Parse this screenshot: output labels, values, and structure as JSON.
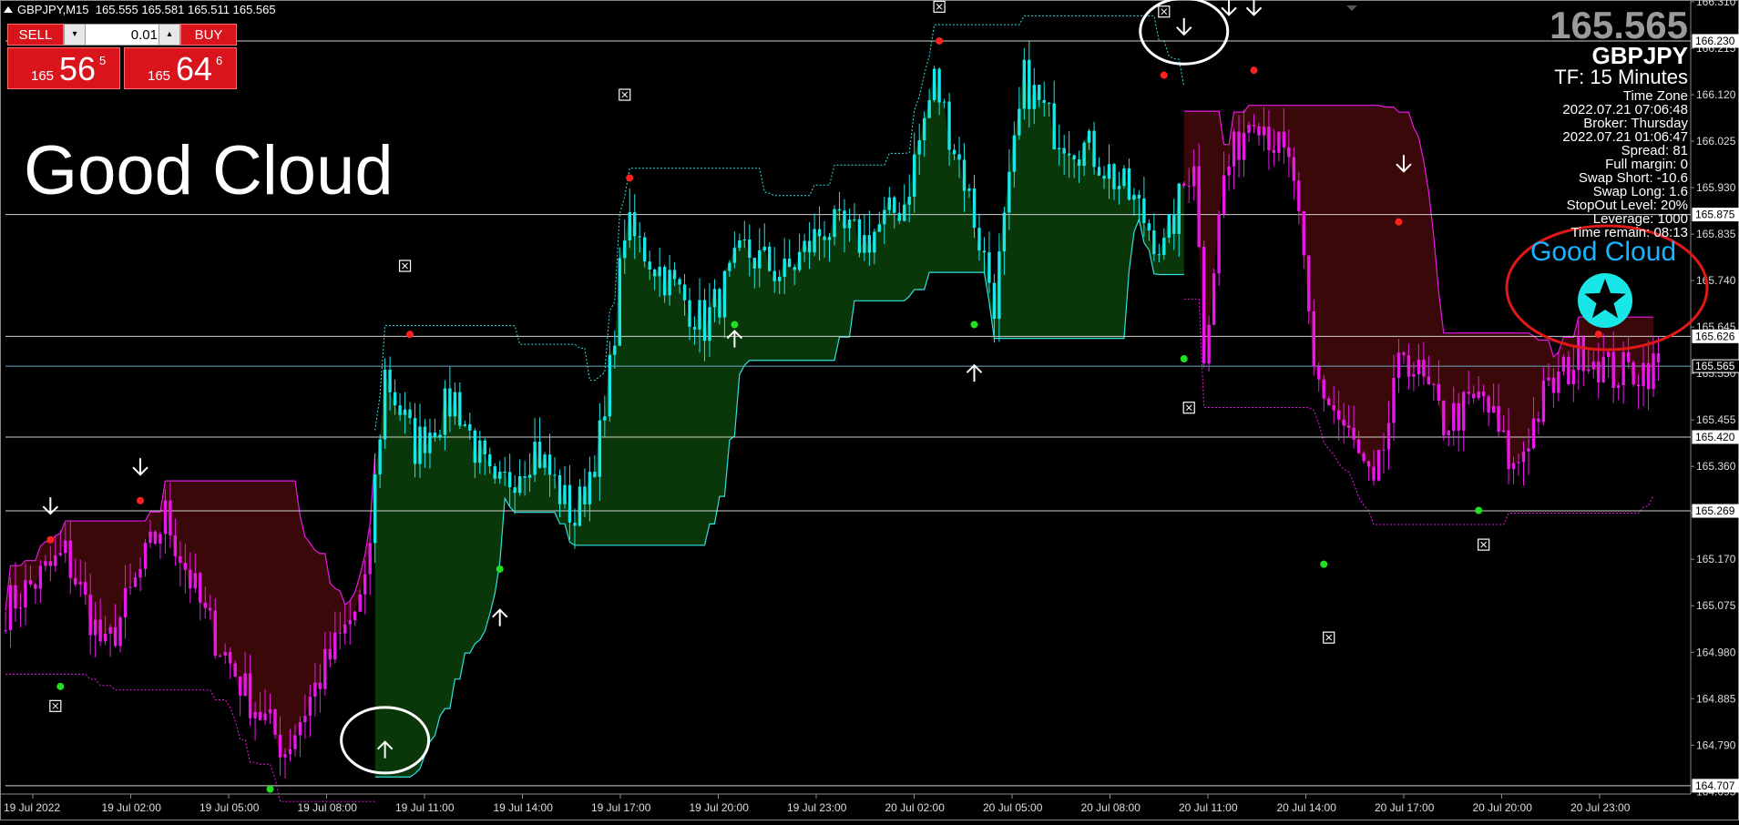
{
  "window": {
    "symbol_header": "GBPJPY,M15",
    "ohlc": "165.555 165.581 165.511 165.565"
  },
  "trade_panel": {
    "sell_label": "SELL",
    "buy_label": "BUY",
    "lot_value": "0.01",
    "sell_price": {
      "small": "165",
      "big": "56",
      "sup": "5"
    },
    "buy_price": {
      "small": "165",
      "big": "64",
      "sup": "6"
    }
  },
  "overlay_title": "Good Cloud",
  "info_panel": {
    "current_price": "165.565",
    "symbol": "GBPJPY",
    "timeframe": "TF: 15 Minutes",
    "rows": [
      "Time Zone",
      "2022.07.21 07:06:48",
      "Broker: Thursday",
      "2022.07.21 01:06:47",
      "Spread:     81",
      "Full margin:       0",
      "Swap Short:  -10.6",
      "Swap Long:     1.6",
      "StopOut Level:  20%",
      "Leverage:  1000",
      "Time remain: 08:13"
    ]
  },
  "indicator_label": "Good Cloud",
  "colors": {
    "background": "#000000",
    "bull_candle": "#19e6e6",
    "bear_candle": "#e619e6",
    "bull_cloud": "#0b3a0b",
    "bear_cloud": "#3d0808",
    "highlight_ring": "#ffffff",
    "annotation_ring": "#e01818",
    "indicator_label": "#19b4ff",
    "star_badge": "#19e6e6"
  },
  "icons": {
    "star": "star-icon",
    "up_arrow": "up-arrow-icon",
    "down_arrow": "down-arrow-icon",
    "fractal_box": "crossed-box-icon"
  },
  "chart_data": {
    "type": "candlestick",
    "symbol": "GBPJPY",
    "timeframe": "M15",
    "ylim": [
      164.69,
      166.31
    ],
    "grid": false,
    "x_tick_labels": [
      "19 Jul 2022",
      "19 Jul 02:00",
      "19 Jul 05:00",
      "19 Jul 08:00",
      "19 Jul 11:00",
      "19 Jul 14:00",
      "19 Jul 17:00",
      "19 Jul 20:00",
      "19 Jul 23:00",
      "20 Jul 02:00",
      "20 Jul 05:00",
      "20 Jul 08:00",
      "20 Jul 11:00",
      "20 Jul 14:00",
      "20 Jul 17:00",
      "20 Jul 20:00",
      "20 Jul 23:00"
    ],
    "y_tick_labels": [
      "166.310",
      "166.215",
      "166.120",
      "166.025",
      "165.930",
      "165.835",
      "165.740",
      "165.645",
      "165.550",
      "165.455",
      "165.360",
      "165.265",
      "165.170",
      "165.075",
      "164.980",
      "164.885",
      "164.790",
      "164.695"
    ],
    "horizontal_levels": [
      {
        "price": "166.230",
        "value": 166.23
      },
      {
        "price": "165.875",
        "value": 165.875
      },
      {
        "price": "165.626",
        "value": 165.626
      },
      {
        "price": "165.565",
        "value": 165.565
      },
      {
        "price": "165.420",
        "value": 165.42
      },
      {
        "price": "165.269",
        "value": 165.269
      },
      {
        "price": "164.707",
        "value": 164.707
      }
    ],
    "current_price": 165.565,
    "price_segments": [
      {
        "x": 0,
        "y": 165.07
      },
      {
        "x": 12,
        "y": 165.18
      },
      {
        "x": 20,
        "y": 164.98
      },
      {
        "x": 32,
        "y": 165.26
      },
      {
        "x": 40,
        "y": 165.05
      },
      {
        "x": 48,
        "y": 164.9
      },
      {
        "x": 56,
        "y": 164.78
      },
      {
        "x": 64,
        "y": 164.95
      },
      {
        "x": 72,
        "y": 165.1
      },
      {
        "x": 76,
        "y": 165.55
      },
      {
        "x": 82,
        "y": 165.4
      },
      {
        "x": 90,
        "y": 165.5
      },
      {
        "x": 98,
        "y": 165.3
      },
      {
        "x": 106,
        "y": 165.4
      },
      {
        "x": 114,
        "y": 165.25
      },
      {
        "x": 120,
        "y": 165.45
      },
      {
        "x": 124,
        "y": 165.85
      },
      {
        "x": 132,
        "y": 165.75
      },
      {
        "x": 140,
        "y": 165.65
      },
      {
        "x": 148,
        "y": 165.8
      },
      {
        "x": 156,
        "y": 165.75
      },
      {
        "x": 164,
        "y": 165.85
      },
      {
        "x": 172,
        "y": 165.82
      },
      {
        "x": 180,
        "y": 165.9
      },
      {
        "x": 186,
        "y": 166.15
      },
      {
        "x": 192,
        "y": 165.95
      },
      {
        "x": 198,
        "y": 165.7
      },
      {
        "x": 204,
        "y": 166.15
      },
      {
        "x": 210,
        "y": 166.05
      },
      {
        "x": 218,
        "y": 166.0
      },
      {
        "x": 226,
        "y": 165.9
      },
      {
        "x": 232,
        "y": 165.8
      },
      {
        "x": 238,
        "y": 166.0
      },
      {
        "x": 240,
        "y": 165.6
      },
      {
        "x": 244,
        "y": 165.95
      },
      {
        "x": 250,
        "y": 166.1
      },
      {
        "x": 258,
        "y": 165.95
      },
      {
        "x": 262,
        "y": 165.55
      },
      {
        "x": 270,
        "y": 165.4
      },
      {
        "x": 274,
        "y": 165.3
      },
      {
        "x": 280,
        "y": 165.6
      },
      {
        "x": 288,
        "y": 165.45
      },
      {
        "x": 296,
        "y": 165.5
      },
      {
        "x": 302,
        "y": 165.35
      },
      {
        "x": 308,
        "y": 165.5
      },
      {
        "x": 316,
        "y": 165.6
      },
      {
        "x": 322,
        "y": 165.55
      },
      {
        "x": 328,
        "y": 165.56
      }
    ],
    "cloud_segments": [
      {
        "from": 0,
        "to": 74,
        "sentiment": "bear",
        "upper": 165.9,
        "lower": 164.75
      },
      {
        "from": 74,
        "to": 236,
        "sentiment": "bull",
        "upper": 166.2,
        "lower": 164.8
      },
      {
        "from": 236,
        "to": 330,
        "sentiment": "bear",
        "upper": 166.2,
        "lower": 165.1
      }
    ],
    "signals": [
      {
        "type": "down",
        "x": 9,
        "y": 165.28
      },
      {
        "type": "down",
        "x": 27,
        "y": 165.36
      },
      {
        "type": "up",
        "x": 76,
        "y": 164.78
      },
      {
        "type": "up",
        "x": 99,
        "y": 165.05
      },
      {
        "type": "up",
        "x": 146,
        "y": 165.62
      },
      {
        "type": "up",
        "x": 194,
        "y": 165.55
      },
      {
        "type": "down",
        "x": 236,
        "y": 166.26
      },
      {
        "type": "down",
        "x": 245,
        "y": 166.3
      },
      {
        "type": "down",
        "x": 250,
        "y": 166.3
      },
      {
        "type": "down",
        "x": 280,
        "y": 165.98
      },
      {
        "type": "down",
        "x": 319,
        "y": 165.69
      }
    ],
    "fractals": [
      {
        "color": "red",
        "x": 9,
        "y": 165.21
      },
      {
        "color": "red",
        "x": 27,
        "y": 165.29
      },
      {
        "color": "green",
        "x": 11,
        "y": 164.91
      },
      {
        "color": "green",
        "x": 53,
        "y": 164.7
      },
      {
        "color": "red",
        "x": 81,
        "y": 165.63
      },
      {
        "color": "green",
        "x": 99,
        "y": 165.15
      },
      {
        "color": "red",
        "x": 125,
        "y": 165.95
      },
      {
        "color": "green",
        "x": 146,
        "y": 165.65
      },
      {
        "color": "red",
        "x": 187,
        "y": 166.23
      },
      {
        "color": "green",
        "x": 194,
        "y": 165.65
      },
      {
        "color": "red",
        "x": 232,
        "y": 166.16
      },
      {
        "color": "red",
        "x": 250,
        "y": 166.17
      },
      {
        "color": "green",
        "x": 236,
        "y": 165.58
      },
      {
        "color": "green",
        "x": 264,
        "y": 165.16
      },
      {
        "color": "red",
        "x": 279,
        "y": 165.86
      },
      {
        "color": "green",
        "x": 295,
        "y": 165.27
      },
      {
        "color": "red",
        "x": 319,
        "y": 165.63
      }
    ],
    "crossed_boxes": [
      {
        "x": 10,
        "y": 164.87
      },
      {
        "x": 80,
        "y": 165.77
      },
      {
        "x": 124,
        "y": 166.12
      },
      {
        "x": 187,
        "y": 166.3
      },
      {
        "x": 232,
        "y": 166.29
      },
      {
        "x": 237,
        "y": 165.48
      },
      {
        "x": 265,
        "y": 165.01
      },
      {
        "x": 296,
        "y": 165.2
      }
    ],
    "highlights": [
      {
        "shape": "circle",
        "color": "white",
        "x": 76,
        "y": 164.8
      },
      {
        "shape": "circle",
        "color": "white",
        "x": 236,
        "y": 166.25
      }
    ]
  }
}
